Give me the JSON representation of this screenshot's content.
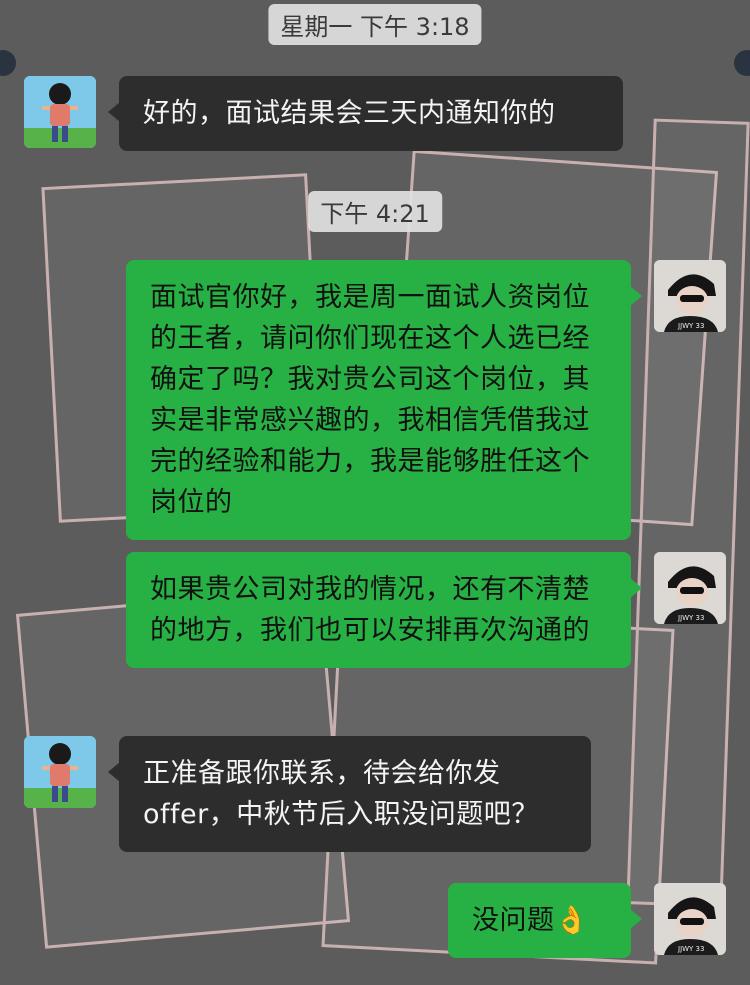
{
  "timestamps": [
    "星期一 下午 3:18",
    "下午 4:21"
  ],
  "messages": [
    {
      "side": "left",
      "text": "好的，面试结果会三天内通知你的"
    },
    {
      "side": "right",
      "text": "面试官你好，我是周一面试人资岗位的王者，请问你们现在这个人选已经确定了吗？我对贵公司这个岗位，其实是非常感兴趣的，我相信凭借我过完的经验和能力，我是能够胜任这个岗位的"
    },
    {
      "side": "right",
      "text": "如果贵公司对我的情况，还有不清楚的地方，我们也可以安排再次沟通的"
    },
    {
      "side": "left",
      "text": "正准备跟你联系，待会给你发offer，中秋节后入职没问题吧？"
    },
    {
      "side": "right",
      "text": "没问题👌"
    }
  ],
  "avatars": {
    "left": "cartoon-character-avatar",
    "right": "person-with-sunglasses-avatar",
    "right_shirt_text": "JJWY 33"
  },
  "colors": {
    "background": "#5c5c5c",
    "received_bubble": "#2d2d2d",
    "sent_bubble": "#27b043",
    "timestamp_bg": "#e1e1e1"
  }
}
